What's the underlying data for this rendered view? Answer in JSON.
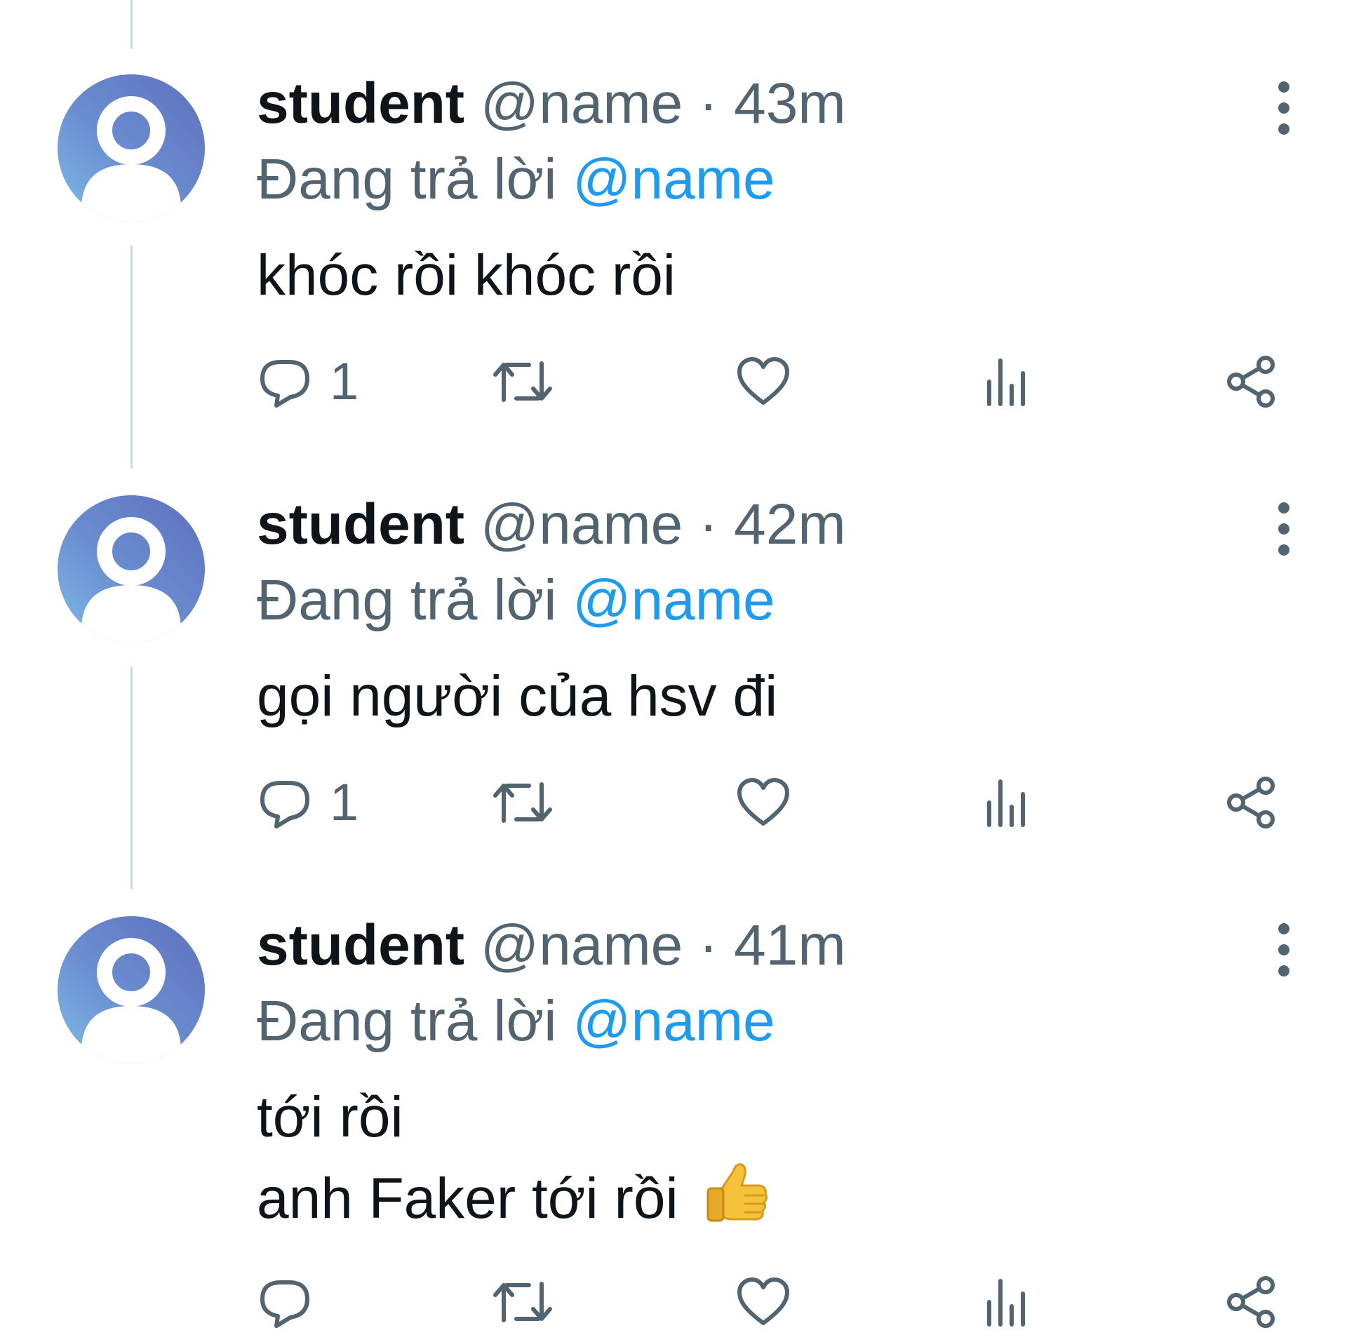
{
  "colors": {
    "text": "#0f1419",
    "secondary": "#536471",
    "accent": "#1d9bf0",
    "thread_line": "#cfd9de"
  },
  "tweets": [
    {
      "display_name": "student",
      "handle": "@name",
      "separator": "·",
      "time": "43m",
      "replying_prefix": "Đang trả lời",
      "replying_handle": "@name",
      "lines": [
        "khóc rồi khóc rồi"
      ],
      "reply_count": "1",
      "icons": [
        "reply-icon",
        "retweet-icon",
        "like-icon",
        "views-icon",
        "share-icon",
        "more-icon"
      ]
    },
    {
      "display_name": "student",
      "handle": "@name",
      "separator": "·",
      "time": "42m",
      "replying_prefix": "Đang trả lời",
      "replying_handle": "@name",
      "lines": [
        "gọi người của hsv đi"
      ],
      "reply_count": "1",
      "icons": [
        "reply-icon",
        "retweet-icon",
        "like-icon",
        "views-icon",
        "share-icon",
        "more-icon"
      ]
    },
    {
      "display_name": "student",
      "handle": "@name",
      "separator": "·",
      "time": "41m",
      "replying_prefix": "Đang trả lời",
      "replying_handle": "@name",
      "lines": [
        "tới rồi",
        "anh Faker tới rồi"
      ],
      "trailing_emoji": "thumbs-up-emoji",
      "reply_count": "",
      "icons": [
        "reply-icon",
        "retweet-icon",
        "like-icon",
        "views-icon",
        "share-icon",
        "more-icon"
      ]
    }
  ]
}
